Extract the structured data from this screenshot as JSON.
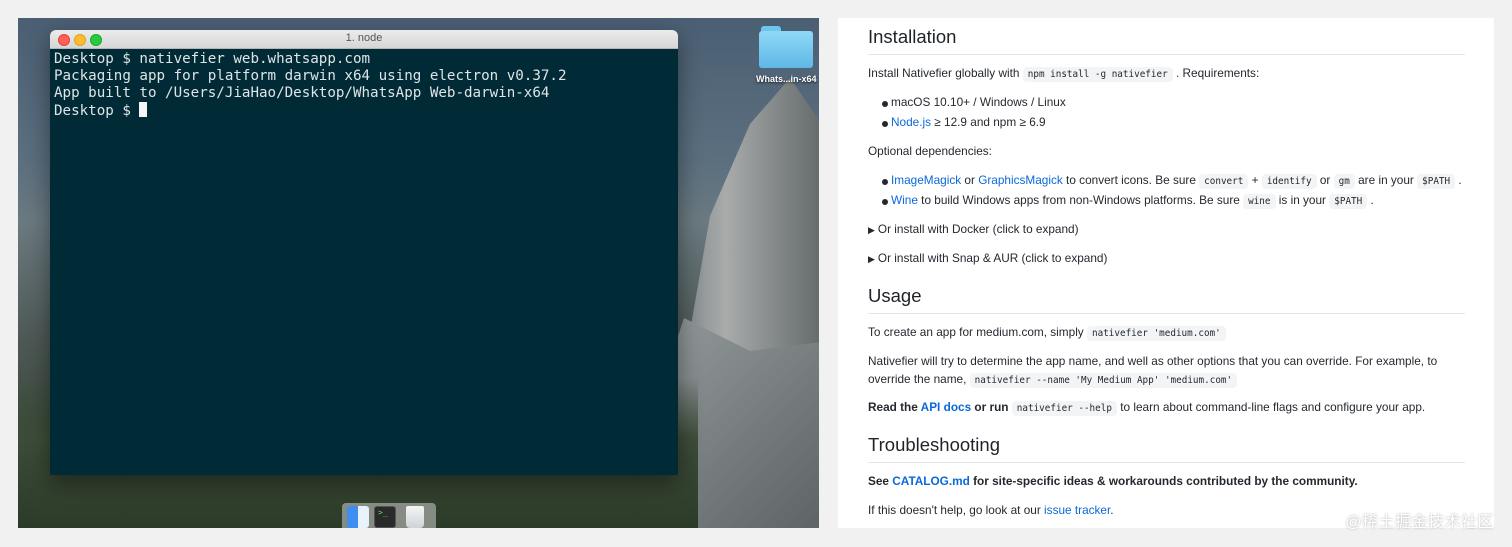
{
  "terminal": {
    "title": "1. node",
    "lines": [
      "Desktop $ nativefier web.whatsapp.com",
      "Packaging app for platform darwin x64 using electron v0.37.2",
      "App built to /Users/JiaHao/Desktop/WhatsApp Web-darwin-x64",
      "Desktop $ "
    ]
  },
  "desktop": {
    "folder_label": "Whats...in-x64",
    "dock_terminal_glyph": ">_"
  },
  "doc": {
    "installation": {
      "heading": "Installation",
      "intro_before": "Install Nativefier globally with ",
      "intro_code": "npm install -g nativefier",
      "intro_after": " . Requirements:",
      "req_1": "macOS 10.10+ / Windows / Linux",
      "req_2_link": "Node.js",
      "req_2_text": " ≥ 12.9 and npm ≥ 6.9",
      "optional_label": "Optional dependencies:",
      "opt_1_link_1": "ImageMagick",
      "opt_1_or": " or ",
      "opt_1_link_2": "GraphicsMagick",
      "opt_1_text": " to convert icons. Be sure ",
      "opt_1_code_1": "convert",
      "opt_1_plus": " + ",
      "opt_1_code_2": "identify",
      "opt_1_or2": " or ",
      "opt_1_code_3": "gm",
      "opt_1_in": " are in your ",
      "opt_1_code_4": "$PATH",
      "opt_1_end": " .",
      "opt_2_link": "Wine",
      "opt_2_text": " to build Windows apps from non-Windows platforms. Be sure ",
      "opt_2_code_1": "wine",
      "opt_2_in": " is in your ",
      "opt_2_code_2": "$PATH",
      "opt_2_end": " .",
      "docker_toggle": "Or install with Docker (click to expand)",
      "snap_toggle": "Or install with Snap & AUR (click to expand)"
    },
    "usage": {
      "heading": "Usage",
      "line_1_text": "To create an app for medium.com, simply ",
      "line_1_code": "nativefier 'medium.com'",
      "line_2_text": "Nativefier will try to determine the app name, and well as other options that you can override. For example, to override the name, ",
      "line_2_code": "nativefier --name 'My Medium App' 'medium.com'",
      "line_3_read": "Read the ",
      "line_3_link": "API docs",
      "line_3_or": " or run ",
      "line_3_code": "nativefier --help",
      "line_3_end": " to learn about command-line flags and configure your app."
    },
    "troubleshooting": {
      "heading": "Troubleshooting",
      "line_1_see": "See ",
      "line_1_link": "CATALOG.md",
      "line_1_text": " for site-specific ideas & workarounds contributed by the community.",
      "line_2_text": "If this doesn't help, go look at our ",
      "line_2_link": "issue tracker",
      "line_2_end": "."
    }
  },
  "watermark": "@稀土掘金技术社区",
  "colors": {
    "terminal_bg": "#002b36",
    "link": "#0969da"
  }
}
